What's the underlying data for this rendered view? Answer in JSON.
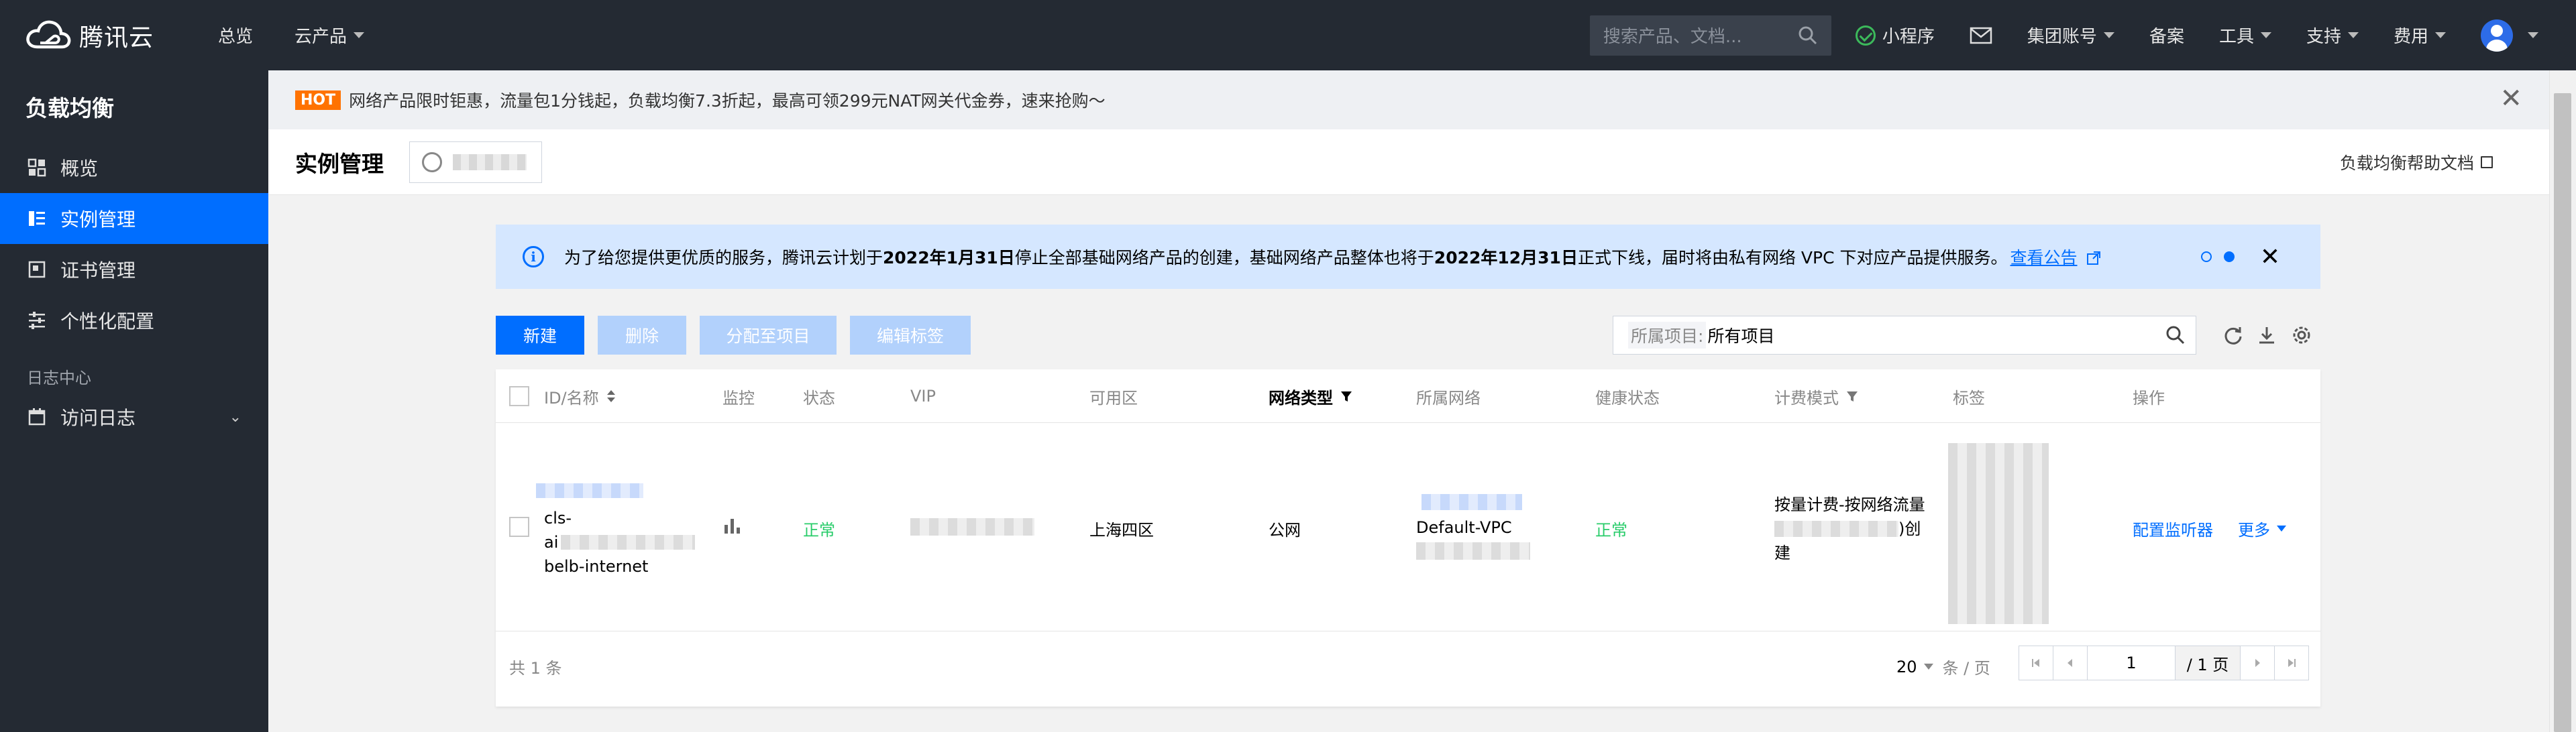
{
  "topbar": {
    "logo_text": "腾讯云",
    "nav": [
      {
        "label": "总览",
        "has_caret": false
      },
      {
        "label": "云产品",
        "has_caret": true
      }
    ],
    "search_placeholder": "搜索产品、文档...",
    "right": [
      {
        "label": "小程序"
      },
      {
        "label": "集团账号",
        "has_caret": true
      },
      {
        "label": "备案"
      },
      {
        "label": "工具",
        "has_caret": true
      },
      {
        "label": "支持",
        "has_caret": true
      },
      {
        "label": "费用",
        "has_caret": true
      }
    ]
  },
  "sidebar": {
    "title": "负载均衡",
    "items": [
      {
        "label": "概览",
        "icon": "grid-icon"
      },
      {
        "label": "实例管理",
        "icon": "list-icon",
        "active": true
      },
      {
        "label": "证书管理",
        "icon": "certificate-icon"
      },
      {
        "label": "个性化配置",
        "icon": "settings-list-icon"
      }
    ],
    "group_label": "日志中心",
    "group_items": [
      {
        "label": "访问日志",
        "icon": "calendar-icon"
      }
    ]
  },
  "promo": {
    "badge": "HOT",
    "text": "网络产品限时钜惠，流量包1分钱起，负载均衡7.3折起，最高可领299元NAT网关代金券，速来抢购～"
  },
  "header": {
    "title": "实例管理",
    "help_link": "负载均衡帮助文档"
  },
  "notice": {
    "text_1": "为了给您提供更优质的服务，腾讯云计划于",
    "date_1": "2022年1月31日",
    "text_2": "停止全部基础网络产品的创建，基础网络产品整体也将于",
    "date_2": "2022年12月31日",
    "text_3": "正式下线，届时将由私有网络 VPC 下对应产品提供服务。",
    "link": "查看公告"
  },
  "actions": {
    "new": "新建",
    "delete": "删除",
    "assign_project": "分配至项目",
    "edit_tags": "编辑标签",
    "filter_label": "所属项目:",
    "filter_value": "所有项目"
  },
  "table": {
    "headers": {
      "id_name": "ID/名称",
      "monitor": "监控",
      "status": "状态",
      "vip": "VIP",
      "zone": "可用区",
      "network_type": "网络类型",
      "network": "所属网络",
      "health": "健康状态",
      "billing": "计费模式",
      "tags": "标签",
      "ops": "操作"
    },
    "row": {
      "id_line1": "cls-",
      "id_line2": "ai",
      "name": "belb-internet",
      "status": "正常",
      "zone": "上海四区",
      "network_type": "公网",
      "network": "Default-VPC",
      "health": "正常",
      "billing_line1": "按量计费-按网络流量",
      "billing_line2_suffix": ")创",
      "billing_line3": "建",
      "op_configure": "配置监听器",
      "op_more": "更多"
    },
    "footer": {
      "total": "共 1 条",
      "page_size": "20",
      "per_page_label": "条 / 页",
      "current_page": "1",
      "total_pages": "/ 1 页"
    }
  },
  "colors": {
    "nav_bg": "#242a33",
    "primary": "#006eff",
    "disabled": "#b2d1fc",
    "success": "#29cc6a",
    "notice_bg": "#d5e7ff",
    "hot_badge": "#ff7200"
  }
}
